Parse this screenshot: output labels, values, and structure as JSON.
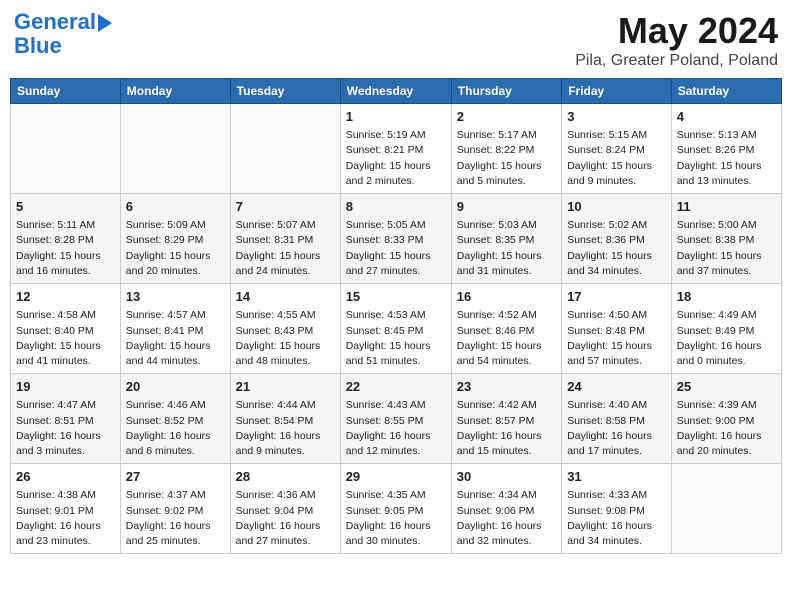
{
  "header": {
    "logo_line1": "General",
    "logo_line2": "Blue",
    "month_title": "May 2024",
    "location": "Pila, Greater Poland, Poland"
  },
  "days_of_week": [
    "Sunday",
    "Monday",
    "Tuesday",
    "Wednesday",
    "Thursday",
    "Friday",
    "Saturday"
  ],
  "weeks": [
    [
      {
        "day": "",
        "info": ""
      },
      {
        "day": "",
        "info": ""
      },
      {
        "day": "",
        "info": ""
      },
      {
        "day": "1",
        "info": "Sunrise: 5:19 AM\nSunset: 8:21 PM\nDaylight: 15 hours\nand 2 minutes."
      },
      {
        "day": "2",
        "info": "Sunrise: 5:17 AM\nSunset: 8:22 PM\nDaylight: 15 hours\nand 5 minutes."
      },
      {
        "day": "3",
        "info": "Sunrise: 5:15 AM\nSunset: 8:24 PM\nDaylight: 15 hours\nand 9 minutes."
      },
      {
        "day": "4",
        "info": "Sunrise: 5:13 AM\nSunset: 8:26 PM\nDaylight: 15 hours\nand 13 minutes."
      }
    ],
    [
      {
        "day": "5",
        "info": "Sunrise: 5:11 AM\nSunset: 8:28 PM\nDaylight: 15 hours\nand 16 minutes."
      },
      {
        "day": "6",
        "info": "Sunrise: 5:09 AM\nSunset: 8:29 PM\nDaylight: 15 hours\nand 20 minutes."
      },
      {
        "day": "7",
        "info": "Sunrise: 5:07 AM\nSunset: 8:31 PM\nDaylight: 15 hours\nand 24 minutes."
      },
      {
        "day": "8",
        "info": "Sunrise: 5:05 AM\nSunset: 8:33 PM\nDaylight: 15 hours\nand 27 minutes."
      },
      {
        "day": "9",
        "info": "Sunrise: 5:03 AM\nSunset: 8:35 PM\nDaylight: 15 hours\nand 31 minutes."
      },
      {
        "day": "10",
        "info": "Sunrise: 5:02 AM\nSunset: 8:36 PM\nDaylight: 15 hours\nand 34 minutes."
      },
      {
        "day": "11",
        "info": "Sunrise: 5:00 AM\nSunset: 8:38 PM\nDaylight: 15 hours\nand 37 minutes."
      }
    ],
    [
      {
        "day": "12",
        "info": "Sunrise: 4:58 AM\nSunset: 8:40 PM\nDaylight: 15 hours\nand 41 minutes."
      },
      {
        "day": "13",
        "info": "Sunrise: 4:57 AM\nSunset: 8:41 PM\nDaylight: 15 hours\nand 44 minutes."
      },
      {
        "day": "14",
        "info": "Sunrise: 4:55 AM\nSunset: 8:43 PM\nDaylight: 15 hours\nand 48 minutes."
      },
      {
        "day": "15",
        "info": "Sunrise: 4:53 AM\nSunset: 8:45 PM\nDaylight: 15 hours\nand 51 minutes."
      },
      {
        "day": "16",
        "info": "Sunrise: 4:52 AM\nSunset: 8:46 PM\nDaylight: 15 hours\nand 54 minutes."
      },
      {
        "day": "17",
        "info": "Sunrise: 4:50 AM\nSunset: 8:48 PM\nDaylight: 15 hours\nand 57 minutes."
      },
      {
        "day": "18",
        "info": "Sunrise: 4:49 AM\nSunset: 8:49 PM\nDaylight: 16 hours\nand 0 minutes."
      }
    ],
    [
      {
        "day": "19",
        "info": "Sunrise: 4:47 AM\nSunset: 8:51 PM\nDaylight: 16 hours\nand 3 minutes."
      },
      {
        "day": "20",
        "info": "Sunrise: 4:46 AM\nSunset: 8:52 PM\nDaylight: 16 hours\nand 6 minutes."
      },
      {
        "day": "21",
        "info": "Sunrise: 4:44 AM\nSunset: 8:54 PM\nDaylight: 16 hours\nand 9 minutes."
      },
      {
        "day": "22",
        "info": "Sunrise: 4:43 AM\nSunset: 8:55 PM\nDaylight: 16 hours\nand 12 minutes."
      },
      {
        "day": "23",
        "info": "Sunrise: 4:42 AM\nSunset: 8:57 PM\nDaylight: 16 hours\nand 15 minutes."
      },
      {
        "day": "24",
        "info": "Sunrise: 4:40 AM\nSunset: 8:58 PM\nDaylight: 16 hours\nand 17 minutes."
      },
      {
        "day": "25",
        "info": "Sunrise: 4:39 AM\nSunset: 9:00 PM\nDaylight: 16 hours\nand 20 minutes."
      }
    ],
    [
      {
        "day": "26",
        "info": "Sunrise: 4:38 AM\nSunset: 9:01 PM\nDaylight: 16 hours\nand 23 minutes."
      },
      {
        "day": "27",
        "info": "Sunrise: 4:37 AM\nSunset: 9:02 PM\nDaylight: 16 hours\nand 25 minutes."
      },
      {
        "day": "28",
        "info": "Sunrise: 4:36 AM\nSunset: 9:04 PM\nDaylight: 16 hours\nand 27 minutes."
      },
      {
        "day": "29",
        "info": "Sunrise: 4:35 AM\nSunset: 9:05 PM\nDaylight: 16 hours\nand 30 minutes."
      },
      {
        "day": "30",
        "info": "Sunrise: 4:34 AM\nSunset: 9:06 PM\nDaylight: 16 hours\nand 32 minutes."
      },
      {
        "day": "31",
        "info": "Sunrise: 4:33 AM\nSunset: 9:08 PM\nDaylight: 16 hours\nand 34 minutes."
      },
      {
        "day": "",
        "info": ""
      }
    ]
  ]
}
